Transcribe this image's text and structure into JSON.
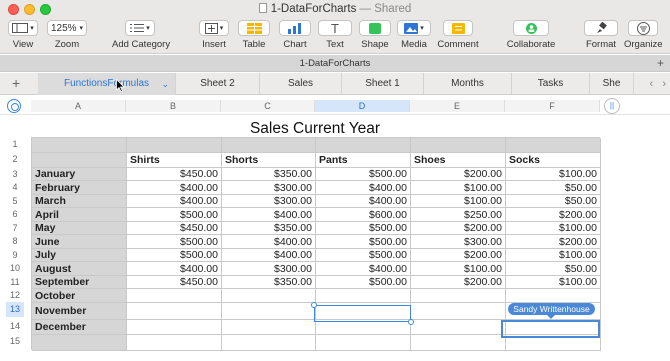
{
  "window": {
    "title": "1-DataForCharts",
    "title_suffix": "— Shared"
  },
  "toolbar": {
    "view": "View",
    "zoom_value": "125%",
    "zoom": "Zoom",
    "add_category": "Add Category",
    "insert": "Insert",
    "table": "Table",
    "chart": "Chart",
    "text": "Text",
    "shape": "Shape",
    "media": "Media",
    "comment": "Comment",
    "collaborate": "Collaborate",
    "format": "Format",
    "organize": "Organize"
  },
  "sheet_name": "1-DataForCharts",
  "tabs": [
    "FunctionsFormulas",
    "Sheet 2",
    "Sales",
    "Sheet 1",
    "Months",
    "Tasks",
    "She"
  ],
  "columns": [
    "A",
    "B",
    "C",
    "D",
    "E",
    "F"
  ],
  "row_numbers": [
    "1",
    "2",
    "3",
    "4",
    "5",
    "6",
    "7",
    "8",
    "9",
    "10",
    "11",
    "12",
    "13",
    "14",
    "15"
  ],
  "table": {
    "title": "Sales Current Year",
    "headers": [
      "",
      "Shirts",
      "Shorts",
      "Pants",
      "Shoes",
      "Socks"
    ],
    "rows": [
      [
        "January",
        "$450.00",
        "$350.00",
        "$500.00",
        "$200.00",
        "$100.00"
      ],
      [
        "February",
        "$400.00",
        "$300.00",
        "$400.00",
        "$100.00",
        "$50.00"
      ],
      [
        "March",
        "$400.00",
        "$300.00",
        "$400.00",
        "$100.00",
        "$50.00"
      ],
      [
        "April",
        "$500.00",
        "$400.00",
        "$600.00",
        "$250.00",
        "$200.00"
      ],
      [
        "May",
        "$450.00",
        "$350.00",
        "$500.00",
        "$200.00",
        "$100.00"
      ],
      [
        "June",
        "$500.00",
        "$400.00",
        "$500.00",
        "$300.00",
        "$200.00"
      ],
      [
        "July",
        "$500.00",
        "$400.00",
        "$500.00",
        "$200.00",
        "$100.00"
      ],
      [
        "August",
        "$400.00",
        "$300.00",
        "$400.00",
        "$100.00",
        "$50.00"
      ],
      [
        "September",
        "$450.00",
        "$350.00",
        "$500.00",
        "$200.00",
        "$100.00"
      ],
      [
        "October",
        "",
        "",
        "",
        "",
        ""
      ],
      [
        "November",
        "",
        "",
        "",
        "",
        ""
      ],
      [
        "December",
        "",
        "",
        "",
        "",
        ""
      ],
      [
        "",
        "",
        "",
        "",
        "",
        ""
      ]
    ]
  },
  "collaborator": "Sandy Writtenhouse",
  "colors": {
    "accent": "#3f87e0",
    "collab": "#4a89d7",
    "header_fill": "#d6d6d6"
  }
}
